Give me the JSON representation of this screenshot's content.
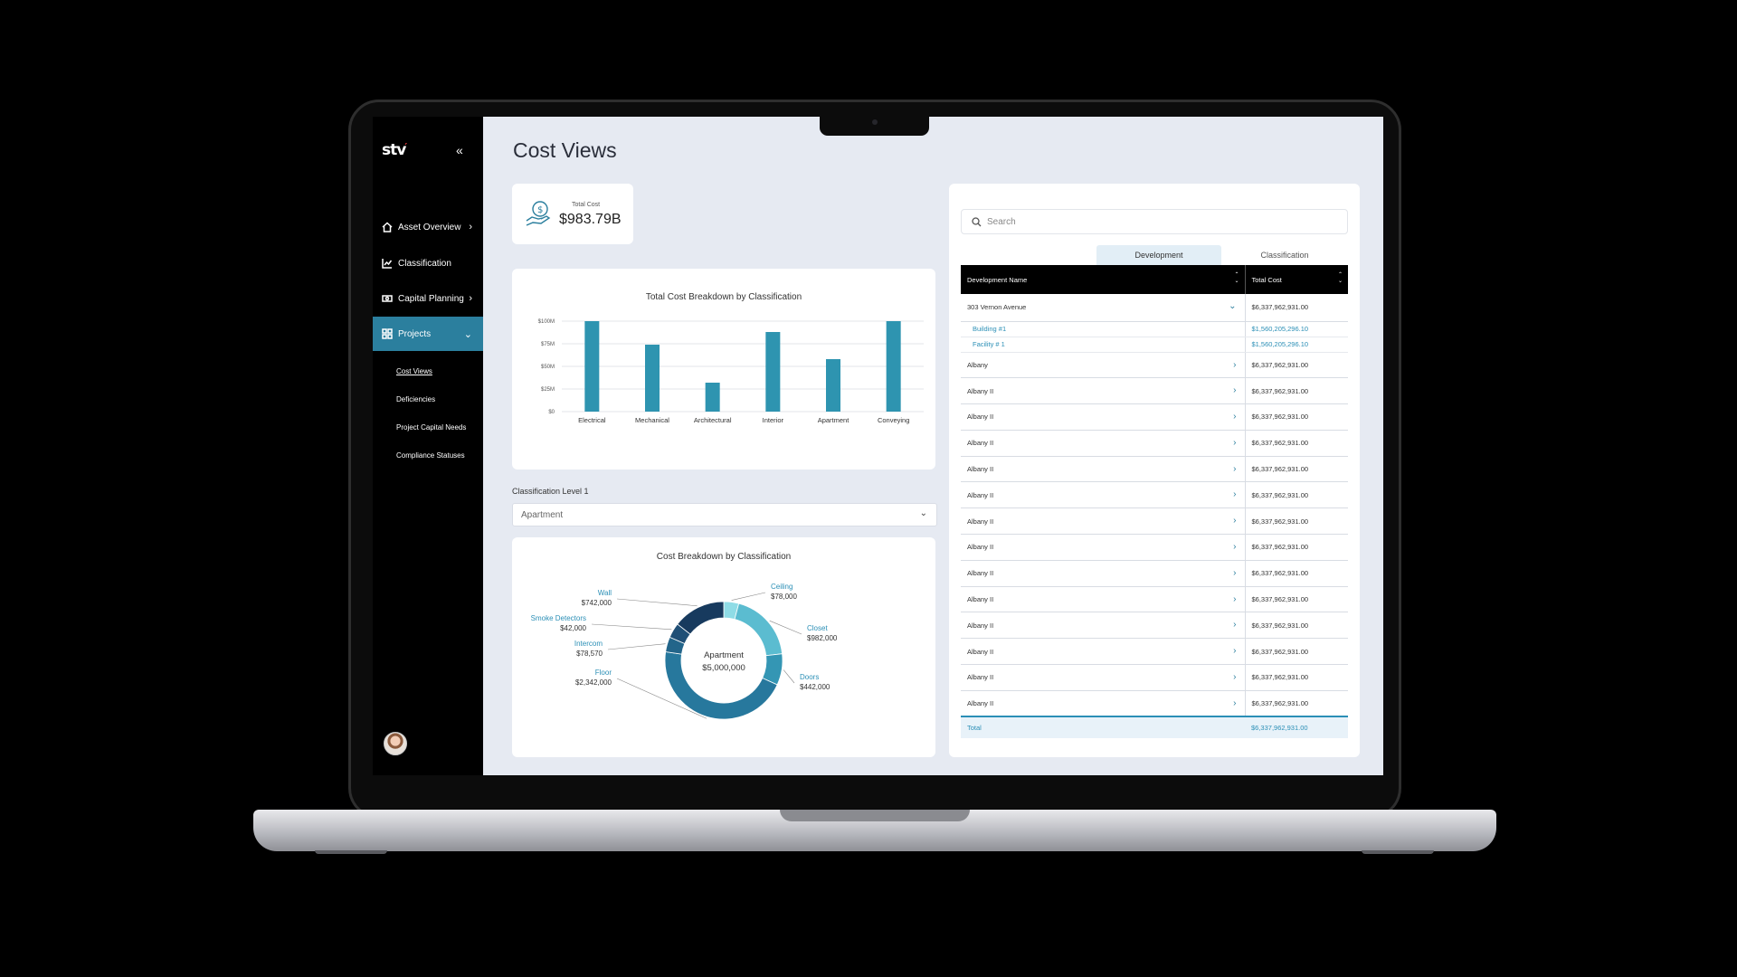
{
  "brand": {
    "logo": "stv",
    "collapse_icon": "double-chevron-left-icon"
  },
  "sidebar": {
    "items": [
      {
        "label": "Asset Overview",
        "icon": "home-icon",
        "has_arrow": true
      },
      {
        "label": "Classification",
        "icon": "line-chart-icon",
        "has_arrow": false
      },
      {
        "label": "Capital Planning",
        "icon": "money-icon",
        "has_arrow": true
      },
      {
        "label": "Projects",
        "icon": "grid-icon",
        "has_arrow": true,
        "active": true
      }
    ],
    "sub_items": [
      "Cost Views",
      "Deficiencies",
      "Project Capital Needs",
      "Compliance Statuses"
    ]
  },
  "page": {
    "title": "Cost Views"
  },
  "kpi": {
    "label": "Total Cost",
    "value": "$983.79B",
    "icon": "cost-hand-icon"
  },
  "filter": {
    "label": "Classification Level 1",
    "value": "Apartment"
  },
  "search": {
    "placeholder": "Search"
  },
  "tabs": [
    "Development",
    "Classification"
  ],
  "table": {
    "headers": [
      "Development Name",
      "Total Cost"
    ],
    "expanded_row": {
      "name": "303 Vernon Avenue",
      "cost": "$6,337,962,931.00"
    },
    "child_rows": [
      {
        "name": "Building #1",
        "cost": "$1,560,205,296.10"
      },
      {
        "name": "Facility # 1",
        "cost": "$1,560,205,296.10"
      }
    ],
    "rows": [
      {
        "name": "Albany",
        "cost": "$6,337,962,931.00"
      },
      {
        "name": "Albany II",
        "cost": "$6,337,962,931.00"
      },
      {
        "name": "Albany II",
        "cost": "$6,337,962,931.00"
      },
      {
        "name": "Albany II",
        "cost": "$6,337,962,931.00"
      },
      {
        "name": "Albany II",
        "cost": "$6,337,962,931.00"
      },
      {
        "name": "Albany II",
        "cost": "$6,337,962,931.00"
      },
      {
        "name": "Albany II",
        "cost": "$6,337,962,931.00"
      },
      {
        "name": "Albany II",
        "cost": "$6,337,962,931.00"
      },
      {
        "name": "Albany II",
        "cost": "$6,337,962,931.00"
      },
      {
        "name": "Albany II",
        "cost": "$6,337,962,931.00"
      },
      {
        "name": "Albany II",
        "cost": "$6,337,962,931.00"
      },
      {
        "name": "Albany II",
        "cost": "$6,337,962,931.00"
      },
      {
        "name": "Albany II",
        "cost": "$6,337,962,931.00"
      },
      {
        "name": "Albany II",
        "cost": "$6,337,962,931.00"
      }
    ],
    "total": {
      "label": "Total",
      "cost": "$6,337,962,931.00"
    }
  },
  "colors": {
    "accent": "#2b7f9e",
    "bar": "#2e94b0",
    "link": "#2b8fb6"
  },
  "chart_data": [
    {
      "type": "bar",
      "title": "Total Cost Breakdown by Classification",
      "categories": [
        "Electrical",
        "Mechanical",
        "Architectural",
        "Interior",
        "Apartment",
        "Conveying"
      ],
      "values": [
        100,
        74,
        32,
        88,
        58,
        100
      ],
      "y_ticks": [
        "$0",
        "$25M",
        "$50M",
        "$75M",
        "$100M"
      ],
      "ylim": [
        0,
        100
      ],
      "grid": true
    },
    {
      "type": "pie",
      "title": "Cost Breakdown by Classification",
      "center_label": "Apartment",
      "center_value": "$5,000,000",
      "slices": [
        {
          "name": "Ceiling",
          "value_label": "$78,000",
          "value": 78000,
          "color": "#8fdce6"
        },
        {
          "name": "Closet",
          "value_label": "$982,000",
          "value": 982000,
          "color": "#5bbcd0"
        },
        {
          "name": "Doors",
          "value_label": "$442,000",
          "value": 442000,
          "color": "#3496b4"
        },
        {
          "name": "Floor",
          "value_label": "$2,342,000",
          "value": 2342000,
          "color": "#27789d"
        },
        {
          "name": "Intercom",
          "value_label": "$78,570",
          "value": 78570,
          "color": "#23658a"
        },
        {
          "name": "Smoke Detectors",
          "value_label": "$42,000",
          "value": 42000,
          "color": "#1f4f76"
        },
        {
          "name": "Wall",
          "value_label": "$742,000",
          "value": 742000,
          "color": "#173a5e"
        }
      ]
    }
  ]
}
